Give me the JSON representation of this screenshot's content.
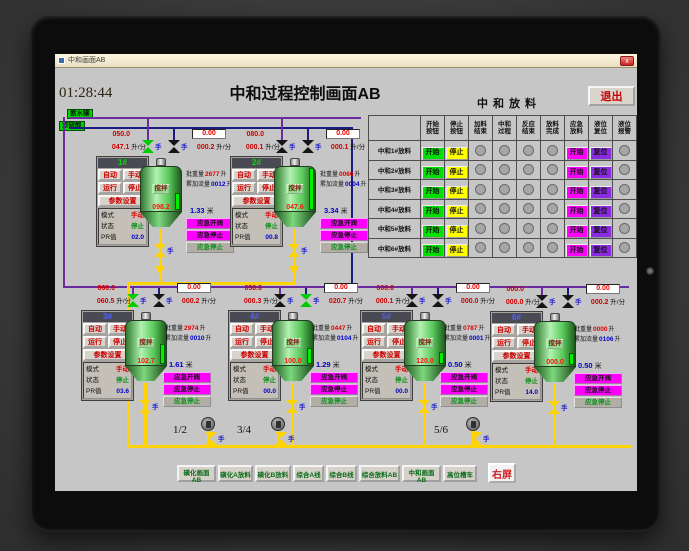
{
  "window": {
    "title": "中和画面AB",
    "close_glyph": "x"
  },
  "header": {
    "time": "01:28:44",
    "title": "中和过程控制画面AB",
    "exit": "退出"
  },
  "source_labels": [
    "氨水罐",
    "浓硫酸"
  ],
  "table": {
    "title": "中和放料",
    "headers": [
      "",
      "开始\n按钮",
      "停止\n按钮",
      "加料\n结束",
      "中和\n过程",
      "反应\n结束",
      "放料\n完成",
      "应急\n放料",
      "液位\n复位",
      "液位\n报警"
    ],
    "start_label": "开始",
    "stop_label": "停止",
    "emg_label": "开始",
    "reset_label": "复位",
    "rows": [
      {
        "label": "中和1#放料"
      },
      {
        "label": "中和2#放料"
      },
      {
        "label": "中和3#放料"
      },
      {
        "label": "中和4#放料"
      },
      {
        "label": "中和5#放料"
      },
      {
        "label": "中和6#放料"
      }
    ]
  },
  "tank_common": {
    "auto": "自动",
    "manual": "手动",
    "run": "运行",
    "stop": "停止",
    "params": "参数设置",
    "mode_label": "模式",
    "mode_val": "手动",
    "state_label": "状态",
    "state_val": "停止",
    "pr_label": "PR值",
    "stir": "搅拌",
    "batch_label": "批重量",
    "accum_label": "累加流量",
    "emg_open": "应急开阀",
    "emg_stop": "应急停止",
    "emg_stop_state": "应急停止",
    "hand": "手"
  },
  "units": {
    "flow": "升/分",
    "volume": "升",
    "level": "米"
  },
  "tanks": [
    {
      "id": "1#",
      "flow_set": "050.0",
      "flow_act": "047.1",
      "box": "0.00",
      "flow2": "000.2",
      "pr": "02.0",
      "batch": "2677",
      "accum": "0012",
      "tank_val": "098.2",
      "level": "1.33"
    },
    {
      "id": "2#",
      "flow_set": "080.0",
      "flow_act": "000.1",
      "box": "0.00",
      "flow2": "000.1",
      "pr": "00.8",
      "batch": "0060",
      "accum": "0004",
      "tank_val": "047.6",
      "level": "3.34"
    },
    {
      "id": "3#",
      "flow_set": "060.0",
      "flow_act": "060.5",
      "box": "0.00",
      "flow2": "000.2",
      "pr": "03.6",
      "batch": "2974",
      "accum": "0010",
      "tank_val": "102.7",
      "level": "1.61"
    },
    {
      "id": "4#",
      "flow_set": "050.0",
      "flow_act": "000.3",
      "box": "0.00",
      "flow2": "020.7",
      "pr": "00.0",
      "batch": "0447",
      "accum": "0104",
      "tank_val": "100.0",
      "level": "1.29"
    },
    {
      "id": "5#",
      "flow_set": "000.0",
      "flow_act": "000.1",
      "box": "0.00",
      "flow2": "000.0",
      "pr": "00.0",
      "batch": "0787",
      "accum": "0001",
      "tank_val": "120.0",
      "level": "0.50"
    },
    {
      "id": "6#",
      "flow_set": "000.0",
      "flow_act": "000.0",
      "box": "0.00",
      "flow2": "000.2",
      "pr": "14.0",
      "batch": "0000",
      "accum": "0106",
      "tank_val": "000.0",
      "level": "0.50"
    }
  ],
  "pumps": [
    "1/2",
    "3/4",
    "5/6"
  ],
  "nav_buttons": [
    "磺化画面AB",
    "磺化A放料",
    "磺化B放料",
    "综合A线",
    "综合B线",
    "综合放料AB",
    "中和画面AB",
    "高位槽车"
  ],
  "right_screen": "右屏",
  "colors": {
    "start_green": "#00e000",
    "stop_yellow": "#ffff00",
    "emg_magenta": "#ff00ff",
    "reset_violet": "#8a2be2",
    "pipe_yellow": "#ffd400",
    "pipe_purple": "#6b2aa0",
    "pipe_navy": "#1c1c80",
    "screen_silver": "#c6c6c6"
  }
}
